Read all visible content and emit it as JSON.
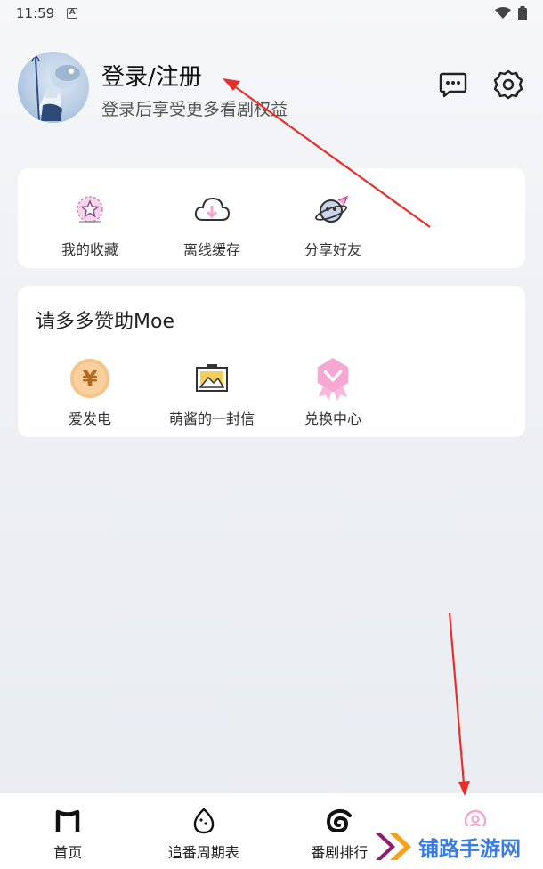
{
  "status_bar": {
    "time": "11:59"
  },
  "profile": {
    "title": "登录/注册",
    "subtitle": "登录后享受更多看剧权益"
  },
  "quick_actions": [
    {
      "label": "我的收藏",
      "icon": "favorite-star-icon"
    },
    {
      "label": "离线缓存",
      "icon": "cloud-download-icon"
    },
    {
      "label": "分享好友",
      "icon": "share-planet-icon"
    }
  ],
  "sponsor": {
    "title": "请多多赞助Moe",
    "items": [
      {
        "label": "爱发电",
        "icon": "yen-coin-icon"
      },
      {
        "label": "萌酱的一封信",
        "icon": "picture-frame-icon"
      },
      {
        "label": "兑换中心",
        "icon": "badge-ribbon-icon"
      }
    ]
  },
  "bottom_nav": [
    {
      "label": "首页",
      "icon": "home-m-icon"
    },
    {
      "label": "追番周期表",
      "icon": "egg-icon"
    },
    {
      "label": "番剧排行",
      "icon": "swirl-icon"
    },
    {
      "label": "",
      "icon": "profile-icon",
      "active": true
    }
  ],
  "watermark": {
    "text": "铺路手游网"
  },
  "colors": {
    "accent_pink": "#f3a6cf",
    "arrow_red": "#e8302a",
    "watermark_blue": "#3a7be0"
  }
}
